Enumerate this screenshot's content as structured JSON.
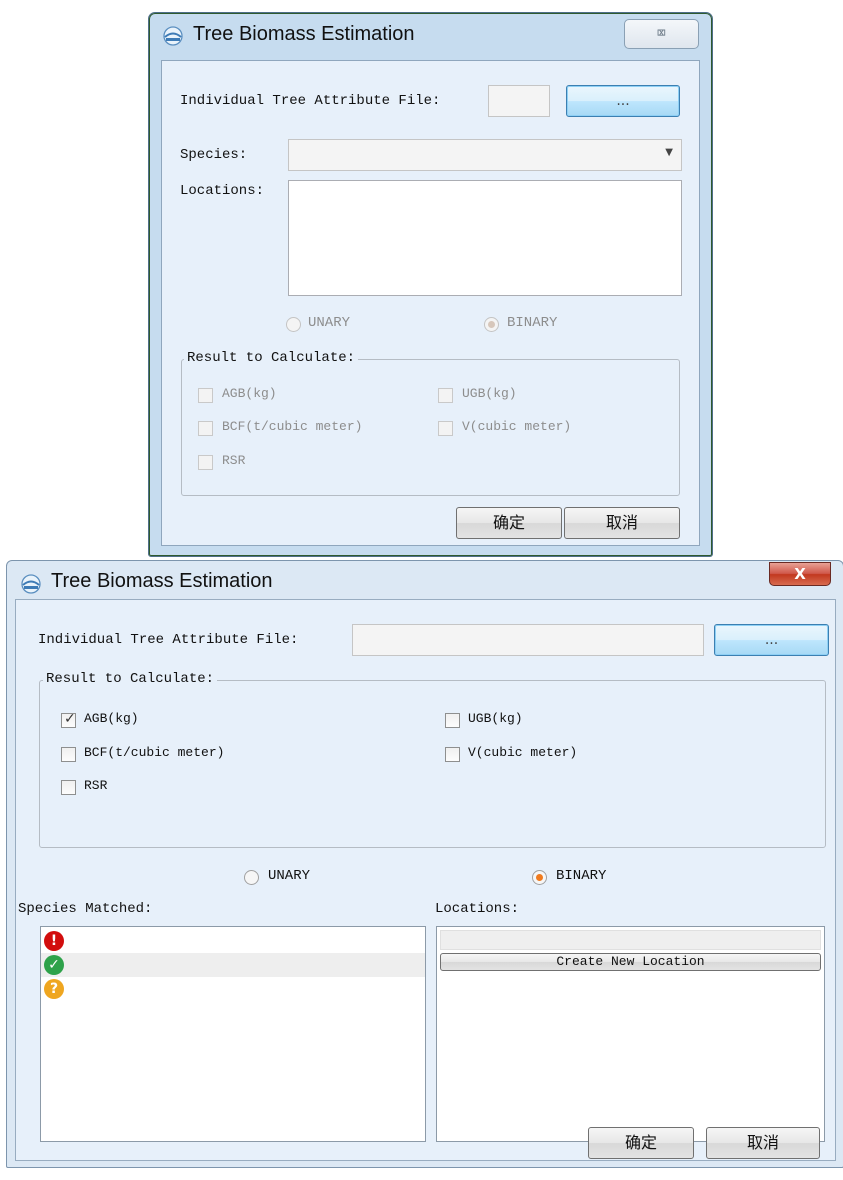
{
  "dialog_top": {
    "title": "Tree Biomass Estimation",
    "close_label": "⌧",
    "file_label": "Individual Tree Attribute File:",
    "file_value": "",
    "browse_label": "...",
    "species_label": "Species:",
    "species_value": "",
    "locations_label": "Locations:",
    "radio_unary": "UNARY",
    "radio_binary": "BINARY",
    "result_group_title": "Result to Calculate:",
    "checkboxes": [
      {
        "label": "AGB(kg)",
        "checked": false
      },
      {
        "label": "UGB(kg)",
        "checked": false
      },
      {
        "label": "BCF(t/cubic meter)",
        "checked": false
      },
      {
        "label": "V(cubic meter)",
        "checked": false
      },
      {
        "label": "RSR",
        "checked": false
      }
    ],
    "ok_label": "确定",
    "cancel_label": "取消"
  },
  "dialog_bottom": {
    "title": "Tree Biomass Estimation",
    "close_label": "X",
    "file_label": "Individual Tree Attribute File:",
    "file_value": "",
    "browse_label": "...",
    "result_group_title": "Result to Calculate:",
    "checkboxes": [
      {
        "label": "AGB(kg)",
        "checked": true
      },
      {
        "label": "UGB(kg)",
        "checked": false
      },
      {
        "label": "BCF(t/cubic meter)",
        "checked": false
      },
      {
        "label": "V(cubic meter)",
        "checked": false
      },
      {
        "label": "RSR",
        "checked": false
      }
    ],
    "radio_unary": "UNARY",
    "radio_binary": "BINARY",
    "species_matched_label": "Species Matched:",
    "species_status": [
      {
        "icon": "error-icon",
        "symbol": "!"
      },
      {
        "icon": "check-icon",
        "symbol": "✓"
      },
      {
        "icon": "question-icon",
        "symbol": "?"
      }
    ],
    "locations_label": "Locations:",
    "create_location_label": "Create New Location",
    "ok_label": "确定",
    "cancel_label": "取消"
  },
  "colors": {
    "radio_selected": "#f07a1d",
    "error": "#d20d0d",
    "success": "#2ea24a",
    "warning": "#efa620",
    "close_button": "#c2381f"
  }
}
